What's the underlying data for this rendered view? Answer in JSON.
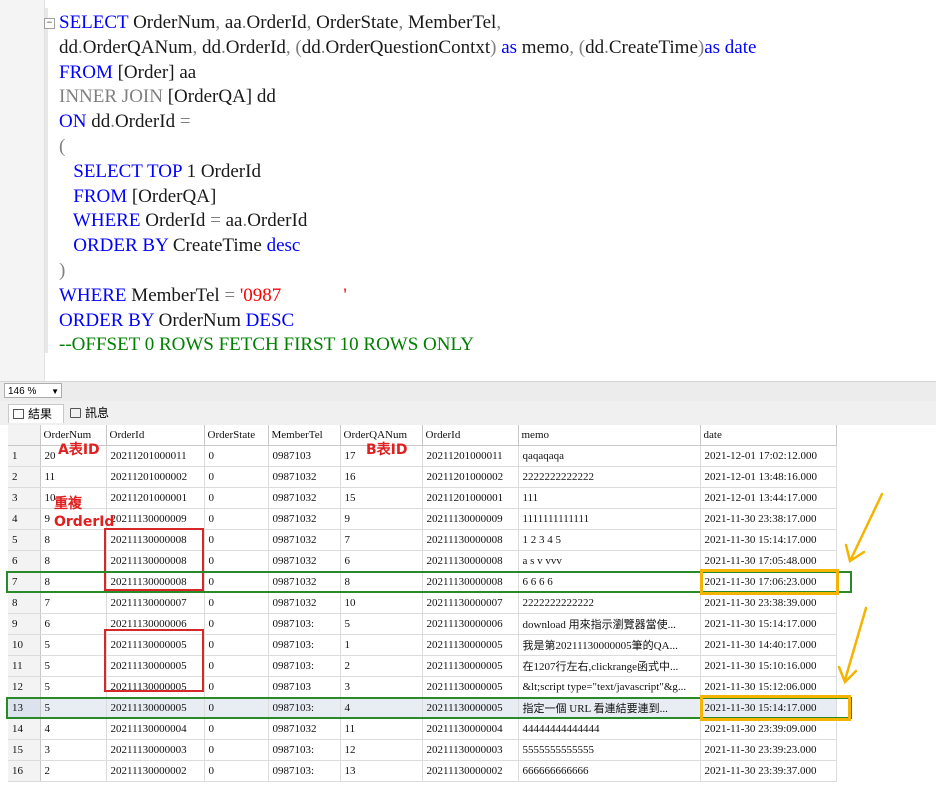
{
  "editor": {
    "lines": [
      [
        [
          "kw",
          "SELECT"
        ],
        [
          "n",
          " OrderNum"
        ],
        [
          "gr",
          ","
        ],
        [
          "n",
          " aa"
        ],
        [
          "gr",
          "."
        ],
        [
          "n",
          "OrderId"
        ],
        [
          "gr",
          ","
        ],
        [
          "n",
          " OrderState"
        ],
        [
          "gr",
          ","
        ],
        [
          "n",
          " MemberTel"
        ],
        [
          "gr",
          ","
        ]
      ],
      [
        [
          "n",
          "dd"
        ],
        [
          "gr",
          "."
        ],
        [
          "n",
          "OrderQANum"
        ],
        [
          "gr",
          ","
        ],
        [
          "n",
          " dd"
        ],
        [
          "gr",
          "."
        ],
        [
          "n",
          "OrderId"
        ],
        [
          "gr",
          ","
        ],
        [
          "n",
          " "
        ],
        [
          "gr",
          "("
        ],
        [
          "n",
          "dd"
        ],
        [
          "gr",
          "."
        ],
        [
          "n",
          "OrderQuestionContxt"
        ],
        [
          "gr",
          ")"
        ],
        [
          "n",
          " "
        ],
        [
          "kw",
          "as"
        ],
        [
          "n",
          " memo"
        ],
        [
          "gr",
          ","
        ],
        [
          "n",
          " "
        ],
        [
          "gr",
          "("
        ],
        [
          "n",
          "dd"
        ],
        [
          "gr",
          "."
        ],
        [
          "n",
          "CreateTime"
        ],
        [
          "gr",
          ")"
        ],
        [
          "kw",
          "as"
        ],
        [
          "n",
          " "
        ],
        [
          "kw",
          "date"
        ]
      ],
      [
        [
          "kw",
          "FROM"
        ],
        [
          "n",
          " [Order] aa"
        ]
      ],
      [
        [
          "gr",
          "INNER JOIN"
        ],
        [
          "n",
          " [OrderQA] dd"
        ]
      ],
      [
        [
          "kw",
          "ON"
        ],
        [
          "n",
          " dd"
        ],
        [
          "gr",
          "."
        ],
        [
          "n",
          "OrderId "
        ],
        [
          "gr",
          "="
        ]
      ],
      [
        [
          "gr",
          "("
        ]
      ],
      [
        [
          "n",
          "   "
        ],
        [
          "kw",
          "SELECT TOP"
        ],
        [
          "n",
          " 1 OrderId"
        ]
      ],
      [
        [
          "n",
          "   "
        ],
        [
          "kw",
          "FROM"
        ],
        [
          "n",
          " [OrderQA]"
        ]
      ],
      [
        [
          "n",
          "   "
        ],
        [
          "kw",
          "WHERE"
        ],
        [
          "n",
          " OrderId "
        ],
        [
          "gr",
          "="
        ],
        [
          "n",
          " aa"
        ],
        [
          "gr",
          "."
        ],
        [
          "n",
          "OrderId"
        ]
      ],
      [
        [
          "n",
          "   "
        ],
        [
          "kw",
          "ORDER BY"
        ],
        [
          "n",
          " CreateTime "
        ],
        [
          "kw",
          "desc"
        ]
      ],
      [
        [
          "gr",
          ")"
        ]
      ],
      [
        [
          "kw",
          "WHERE"
        ],
        [
          "n",
          " MemberTel "
        ],
        [
          "gr",
          "="
        ],
        [
          "n",
          " "
        ],
        [
          "st",
          "'0987"
        ],
        [
          "redact",
          ""
        ],
        [
          "st",
          "'"
        ]
      ],
      [
        [
          "kw",
          "ORDER BY"
        ],
        [
          "n",
          " OrderNum "
        ],
        [
          "kw",
          "DESC"
        ]
      ],
      [
        [
          "cm",
          "--OFFSET 0 ROWS FETCH FIRST 10 ROWS ONLY"
        ]
      ]
    ]
  },
  "zoom": {
    "value": "146 %"
  },
  "tabs": {
    "results": "結果",
    "messages": "訊息"
  },
  "grid": {
    "columns": [
      "",
      "OrderNum",
      "OrderId",
      "OrderState",
      "MemberTel",
      "OrderQANum",
      "OrderId",
      "memo",
      "date"
    ],
    "rows": [
      [
        "1",
        "20",
        "20211201000011",
        "0",
        "0987103",
        "17",
        "20211201000011",
        "qaqaqaqa",
        "2021-12-01 17:02:12.000"
      ],
      [
        "2",
        "11",
        "20211201000002",
        "0",
        "09871032",
        "16",
        "20211201000002",
        "2222222222222",
        "2021-12-01 13:48:16.000"
      ],
      [
        "3",
        "10",
        "20211201000001",
        "0",
        "09871032",
        "15",
        "20211201000001",
        "111",
        "2021-12-01 13:44:17.000"
      ],
      [
        "4",
        "9",
        "20211130000009",
        "0",
        "09871032",
        "9",
        "20211130000009",
        "1111111111111",
        "2021-11-30 23:38:17.000"
      ],
      [
        "5",
        "8",
        "20211130000008",
        "0",
        "09871032",
        "7",
        "20211130000008",
        "1 2 3 4 5",
        "2021-11-30 15:14:17.000"
      ],
      [
        "6",
        "8",
        "20211130000008",
        "0",
        "09871032",
        "6",
        "20211130000008",
        "a s v vvv",
        "2021-11-30 17:05:48.000"
      ],
      [
        "7",
        "8",
        "20211130000008",
        "0",
        "09871032",
        "8",
        "20211130000008",
        "6 6 6 6",
        "2021-11-30 17:06:23.000"
      ],
      [
        "8",
        "7",
        "20211130000007",
        "0",
        "09871032",
        "10",
        "20211130000007",
        "2222222222222",
        "2021-11-30 23:38:39.000"
      ],
      [
        "9",
        "6",
        "20211130000006",
        "0",
        "0987103:",
        "5",
        "20211130000006",
        "download 用來指示瀏覽器當使...",
        "2021-11-30 15:14:17.000"
      ],
      [
        "10",
        "5",
        "20211130000005",
        "0",
        "0987103:",
        "1",
        "20211130000005",
        "我是第20211130000005筆的QA...",
        "2021-11-30 14:40:17.000"
      ],
      [
        "11",
        "5",
        "20211130000005",
        "0",
        "0987103:",
        "2",
        "20211130000005",
        "在1207行左右,clickrange函式中...",
        "2021-11-30 15:10:16.000"
      ],
      [
        "12",
        "5",
        "20211130000005",
        "0",
        "0987103",
        "3",
        "20211130000005",
        "&lt;script type=\"text/javascript\"&g...",
        "2021-11-30 15:12:06.000"
      ],
      [
        "13",
        "5",
        "20211130000005",
        "0",
        "0987103:",
        "4",
        "20211130000005",
        "指定一個 URL 看連結要連到...",
        "2021-11-30 15:14:17.000"
      ],
      [
        "14",
        "4",
        "20211130000004",
        "0",
        "09871032",
        "11",
        "20211130000004",
        "44444444444444",
        "2021-11-30 23:39:09.000"
      ],
      [
        "15",
        "3",
        "20211130000003",
        "0",
        "0987103:",
        "12",
        "20211130000003",
        "5555555555555",
        "2021-11-30 23:39:23.000"
      ],
      [
        "16",
        "2",
        "20211130000002",
        "0",
        "0987103:",
        "13",
        "20211130000002",
        "666666666666",
        "2021-11-30 23:39:37.000"
      ]
    ],
    "selected_row": 13
  },
  "annotations": {
    "a_id": "A表ID",
    "b_id": "B表ID",
    "dup": "重複\nOrderId"
  },
  "colors": {
    "keyword": "#0000ff",
    "comment": "#008000",
    "string": "#ff0000",
    "annotation_red": "#d62828",
    "annotation_orange": "#f4b400",
    "annotation_green": "#2a8a2a"
  }
}
